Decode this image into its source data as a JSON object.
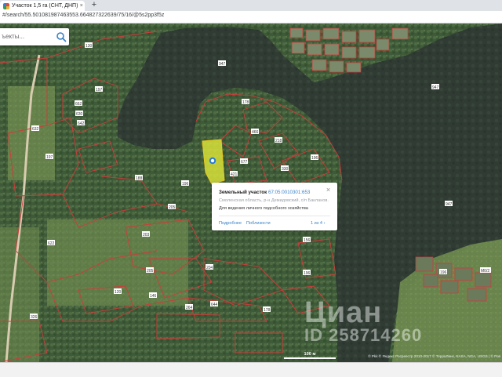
{
  "browser": {
    "tab_title": "Участок 1,5 га (СНТ, ДНП) на п",
    "tab_close": "×",
    "new_tab": "+",
    "url": "#/search/55.501081987463553.664827322639/75/16/@5s2pp3f5z"
  },
  "search": {
    "placeholder": "ъекты..."
  },
  "popup": {
    "type": "Земельный участок",
    "cadastral_number": "67:05:0010301:653",
    "address": "Смоленская область, р-н Демидовский, с/п Бакланов...",
    "use": "Для ведения личного подсобного хозяйства",
    "details_link": "Подробнее",
    "nearby_link": "Поблизости",
    "pager": "1 из 4",
    "close": "×"
  },
  "scale": {
    "label": "100 м"
  },
  "attribution": "© Pkk © Яндекс Росреестр 2010-2017 © ТерраЛинк, NASA, NGA, USGS | © Ров",
  "watermark": {
    "logo": "Циан",
    "id": "ID 258714260"
  },
  "map_labels": [
    "130",
    "129",
    "947",
    "947",
    "97",
    "662",
    "630",
    "642",
    "632",
    "684",
    "197",
    "188",
    "639",
    "646",
    "430",
    "429",
    "185",
    "140",
    "150",
    "149",
    "146",
    "647",
    "197",
    "298",
    "247",
    "148",
    "158",
    "150",
    "140",
    "330",
    "330",
    "147",
    "647",
    "947",
    "97",
    "330",
    "600",
    "602",
    "602",
    "146",
    "140",
    "620",
    "630",
    "640",
    "124",
    "130",
    "140",
    "181",
    "142",
    "119",
    "188",
    "192",
    "162",
    "162",
    "165",
    "130",
    "124",
    "128",
    "122",
    "300",
    "318",
    "340",
    "342",
    "340",
    "326",
    "322"
  ]
}
